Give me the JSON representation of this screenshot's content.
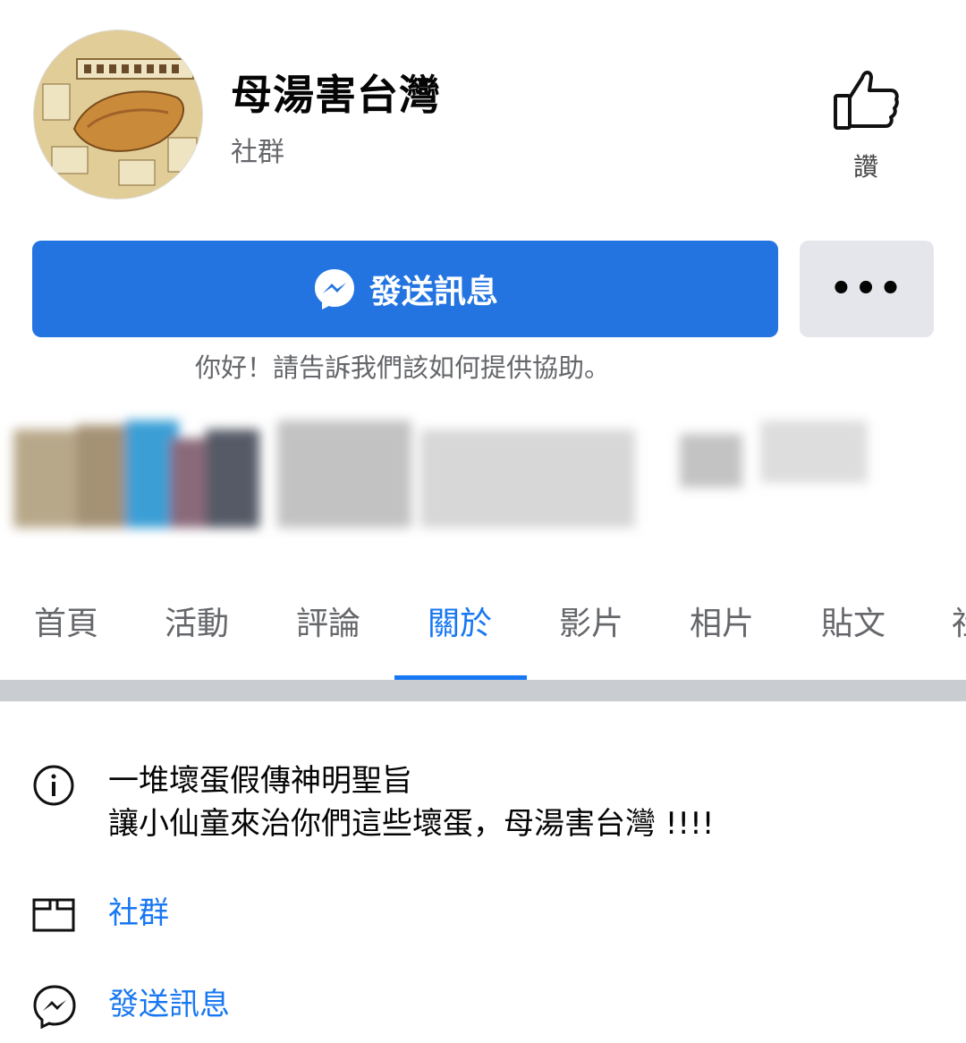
{
  "page": {
    "title": "母湯害台灣",
    "category": "社群",
    "like_label": "讚"
  },
  "actions": {
    "send_message_label": "發送訊息",
    "more_label": "•••",
    "helper_text": "你好！請告訴我們該如何提供協助。"
  },
  "tabs": [
    {
      "label": "首頁",
      "active": false
    },
    {
      "label": "活動",
      "active": false
    },
    {
      "label": "評論",
      "active": false
    },
    {
      "label": "關於",
      "active": true
    },
    {
      "label": "影片",
      "active": false
    },
    {
      "label": "相片",
      "active": false
    },
    {
      "label": "貼文",
      "active": false
    },
    {
      "label": "社",
      "active": false
    }
  ],
  "about": {
    "description_line1": "一堆壞蛋假傳神明聖旨",
    "description_line2": "讓小仙童來治你們這些壞蛋，母湯害台灣 !!!!",
    "category_link": "社群",
    "message_link": "發送訊息"
  },
  "colors": {
    "primary_blue": "#2374e1",
    "link_blue": "#1877f2",
    "secondary_gray": "#e4e6eb",
    "muted_text": "#65676b",
    "divider": "#c9ccd1"
  },
  "icons": [
    "map-avatar",
    "thumbs-up-icon",
    "messenger-icon",
    "more-dots-icon",
    "info-icon",
    "flag-icon",
    "messenger-outline-icon"
  ]
}
